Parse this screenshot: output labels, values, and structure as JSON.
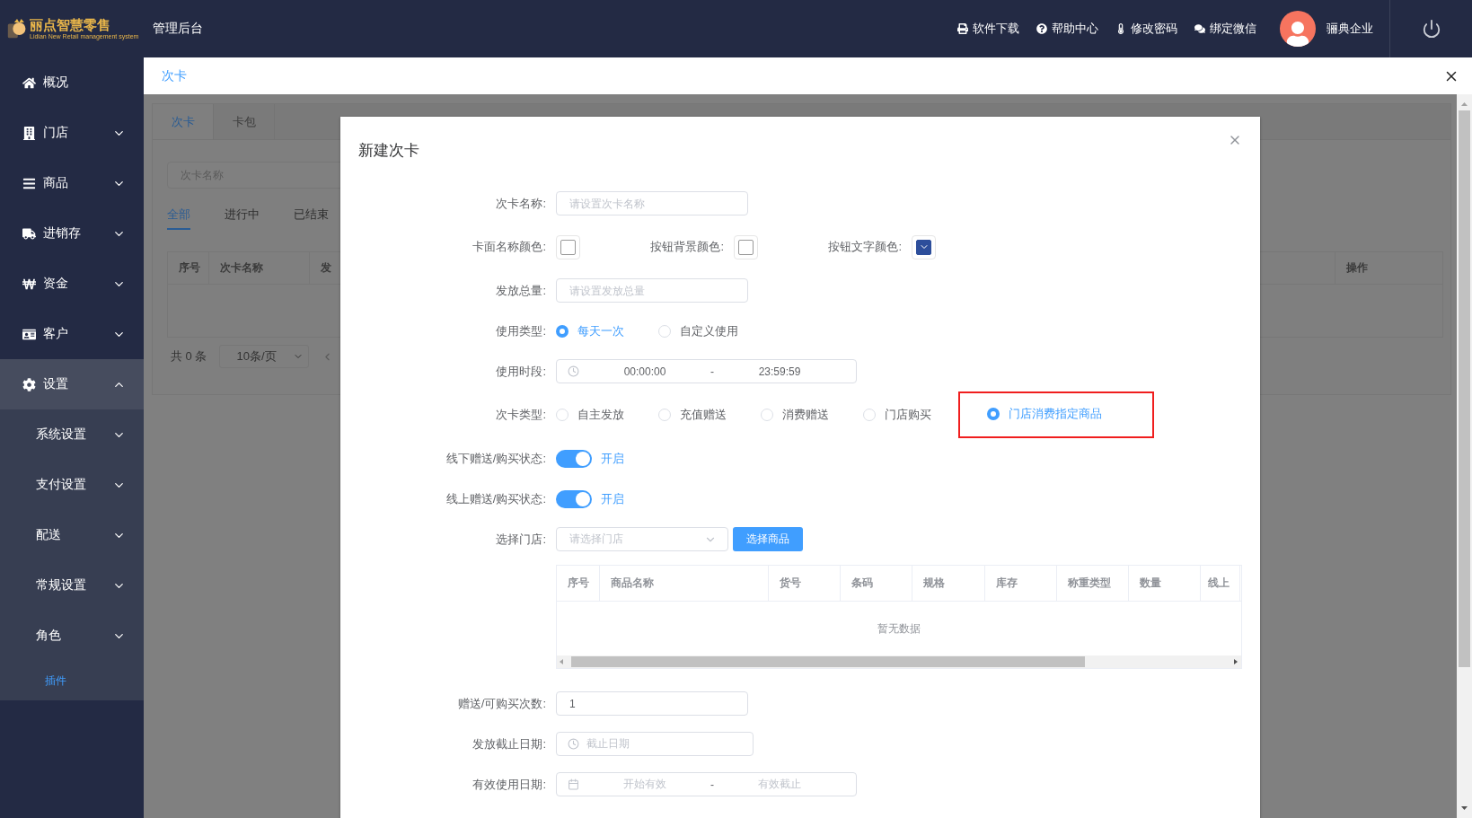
{
  "header": {
    "logo_text": "丽点智慧零售",
    "logo_subtitle": "Lidian New Retail management system",
    "title": "管理后台",
    "links": [
      "软件下载",
      "帮助中心",
      "修改密码",
      "绑定微信"
    ],
    "user": "骊典企业"
  },
  "sidebar": {
    "items": [
      {
        "label": "概况",
        "kind": "link",
        "selected": false
      },
      {
        "label": "门店",
        "kind": "group",
        "expanded": false,
        "selected": false
      },
      {
        "label": "商品",
        "kind": "group",
        "expanded": false,
        "selected": false
      },
      {
        "label": "进销存",
        "kind": "group",
        "expanded": false,
        "selected": false
      },
      {
        "label": "资金",
        "kind": "group",
        "expanded": false,
        "selected": false
      },
      {
        "label": "客户",
        "kind": "group",
        "expanded": false,
        "selected": false
      },
      {
        "label": "设置",
        "kind": "group",
        "expanded": true,
        "selected": false,
        "children": [
          {
            "label": "系统设置",
            "kind": "group",
            "expanded": false,
            "selected": false
          },
          {
            "label": "支付设置",
            "kind": "group",
            "expanded": false,
            "selected": false
          },
          {
            "label": "配送",
            "kind": "group",
            "expanded": false,
            "selected": false
          },
          {
            "label": "常规设置",
            "kind": "group",
            "expanded": false,
            "selected": false
          },
          {
            "label": "角色",
            "kind": "group",
            "expanded": false,
            "selected": false
          },
          {
            "label": "插件",
            "kind": "link",
            "selected": true
          }
        ]
      }
    ]
  },
  "page_tabs": [
    {
      "label": "次卡",
      "selected": true
    }
  ],
  "background": {
    "tabs": [
      {
        "label": "次卡",
        "selected": true
      },
      {
        "label": "卡包",
        "selected": false
      }
    ],
    "search": {
      "placeholder": "次卡名称"
    },
    "filters": [
      {
        "label": "全部",
        "selected": true
      },
      {
        "label": "进行中",
        "selected": false
      },
      {
        "label": "已结束",
        "selected": false
      }
    ],
    "table": {
      "columns": [
        "序号",
        "次卡名称",
        "发",
        "操作"
      ]
    },
    "pagination": {
      "total": "共 0 条",
      "page_size": "10条/页"
    }
  },
  "dialog": {
    "title": "新建次卡",
    "fields": [
      {
        "kind": "text",
        "label": "次卡名称:",
        "placeholder": "请设置次卡名称"
      },
      {
        "kind": "colors",
        "items": [
          {
            "label": "卡面名称颜色:"
          },
          {
            "label": "按钮背景颜色:"
          },
          {
            "label": "按钮文字颜色:",
            "color": "#2d4e9b"
          }
        ]
      },
      {
        "kind": "text",
        "label": "发放总量:",
        "placeholder": "请设置发放总量"
      },
      {
        "kind": "radio",
        "label": "使用类型:",
        "options": [
          {
            "label": "每天一次",
            "selected": true
          },
          {
            "label": "自定义使用",
            "selected": false
          }
        ]
      },
      {
        "kind": "time_range",
        "label": "使用时段:",
        "start": "00:00:00",
        "separator": "-",
        "end": "23:59:59"
      },
      {
        "kind": "radio",
        "label": "次卡类型:",
        "options": [
          {
            "label": "自主发放",
            "selected": false
          },
          {
            "label": "充值赠送",
            "selected": false
          },
          {
            "label": "消费赠送",
            "selected": false
          },
          {
            "label": "门店购买",
            "selected": false
          },
          {
            "label": "门店消费指定商品",
            "selected": true,
            "highlighted": true
          }
        ]
      },
      {
        "kind": "switch",
        "label": "线下赠送/购买状态:",
        "on": true,
        "text": "开启"
      },
      {
        "kind": "switch",
        "label": "线上赠送/购买状态:",
        "on": true,
        "text": "开启"
      },
      {
        "kind": "select_button",
        "label": "选择门店:",
        "placeholder": "请选择门店",
        "button": "选择商品"
      },
      {
        "kind": "table",
        "columns": [
          "序号",
          "商品名称",
          "货号",
          "条码",
          "规格",
          "库存",
          "称重类型",
          "数量",
          "线上"
        ],
        "empty": "暂无数据"
      },
      {
        "kind": "value",
        "label": "赠送/可购买次数:",
        "value": "1"
      },
      {
        "kind": "date",
        "label": "发放截止日期:",
        "placeholder": "截止日期"
      },
      {
        "kind": "date_range",
        "label": "有效使用日期:",
        "start": "开始有效",
        "separator": "-",
        "end": "有效截止"
      }
    ]
  }
}
